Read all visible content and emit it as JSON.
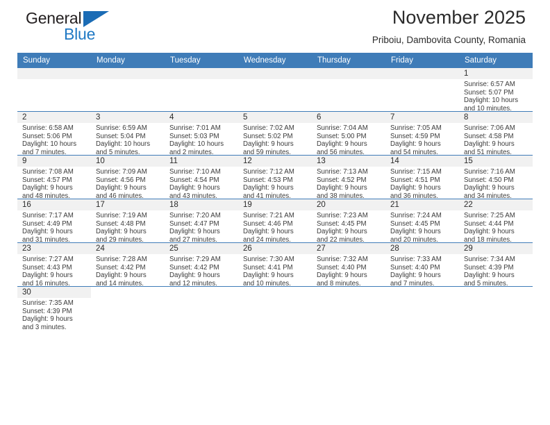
{
  "brand": {
    "name_top": "General",
    "name_bottom": "Blue"
  },
  "header": {
    "title": "November 2025",
    "subtitle": "Priboiu, Dambovita County, Romania"
  },
  "weekdays": [
    "Sunday",
    "Monday",
    "Tuesday",
    "Wednesday",
    "Thursday",
    "Friday",
    "Saturday"
  ],
  "colors": {
    "header_blue": "#3f7cb8",
    "brand_blue": "#2079c4",
    "daynum_strip": "#f1f1f1"
  },
  "weeks": [
    [
      {
        "empty": true
      },
      {
        "empty": true
      },
      {
        "empty": true
      },
      {
        "empty": true
      },
      {
        "empty": true
      },
      {
        "empty": true
      },
      {
        "day": "1",
        "sunrise": "Sunrise: 6:57 AM",
        "sunset": "Sunset: 5:07 PM",
        "daylight1": "Daylight: 10 hours",
        "daylight2": "and 10 minutes."
      }
    ],
    [
      {
        "day": "2",
        "sunrise": "Sunrise: 6:58 AM",
        "sunset": "Sunset: 5:06 PM",
        "daylight1": "Daylight: 10 hours",
        "daylight2": "and 7 minutes."
      },
      {
        "day": "3",
        "sunrise": "Sunrise: 6:59 AM",
        "sunset": "Sunset: 5:04 PM",
        "daylight1": "Daylight: 10 hours",
        "daylight2": "and 5 minutes."
      },
      {
        "day": "4",
        "sunrise": "Sunrise: 7:01 AM",
        "sunset": "Sunset: 5:03 PM",
        "daylight1": "Daylight: 10 hours",
        "daylight2": "and 2 minutes."
      },
      {
        "day": "5",
        "sunrise": "Sunrise: 7:02 AM",
        "sunset": "Sunset: 5:02 PM",
        "daylight1": "Daylight: 9 hours",
        "daylight2": "and 59 minutes."
      },
      {
        "day": "6",
        "sunrise": "Sunrise: 7:04 AM",
        "sunset": "Sunset: 5:00 PM",
        "daylight1": "Daylight: 9 hours",
        "daylight2": "and 56 minutes."
      },
      {
        "day": "7",
        "sunrise": "Sunrise: 7:05 AM",
        "sunset": "Sunset: 4:59 PM",
        "daylight1": "Daylight: 9 hours",
        "daylight2": "and 54 minutes."
      },
      {
        "day": "8",
        "sunrise": "Sunrise: 7:06 AM",
        "sunset": "Sunset: 4:58 PM",
        "daylight1": "Daylight: 9 hours",
        "daylight2": "and 51 minutes."
      }
    ],
    [
      {
        "day": "9",
        "sunrise": "Sunrise: 7:08 AM",
        "sunset": "Sunset: 4:57 PM",
        "daylight1": "Daylight: 9 hours",
        "daylight2": "and 48 minutes."
      },
      {
        "day": "10",
        "sunrise": "Sunrise: 7:09 AM",
        "sunset": "Sunset: 4:56 PM",
        "daylight1": "Daylight: 9 hours",
        "daylight2": "and 46 minutes."
      },
      {
        "day": "11",
        "sunrise": "Sunrise: 7:10 AM",
        "sunset": "Sunset: 4:54 PM",
        "daylight1": "Daylight: 9 hours",
        "daylight2": "and 43 minutes."
      },
      {
        "day": "12",
        "sunrise": "Sunrise: 7:12 AM",
        "sunset": "Sunset: 4:53 PM",
        "daylight1": "Daylight: 9 hours",
        "daylight2": "and 41 minutes."
      },
      {
        "day": "13",
        "sunrise": "Sunrise: 7:13 AM",
        "sunset": "Sunset: 4:52 PM",
        "daylight1": "Daylight: 9 hours",
        "daylight2": "and 38 minutes."
      },
      {
        "day": "14",
        "sunrise": "Sunrise: 7:15 AM",
        "sunset": "Sunset: 4:51 PM",
        "daylight1": "Daylight: 9 hours",
        "daylight2": "and 36 minutes."
      },
      {
        "day": "15",
        "sunrise": "Sunrise: 7:16 AM",
        "sunset": "Sunset: 4:50 PM",
        "daylight1": "Daylight: 9 hours",
        "daylight2": "and 34 minutes."
      }
    ],
    [
      {
        "day": "16",
        "sunrise": "Sunrise: 7:17 AM",
        "sunset": "Sunset: 4:49 PM",
        "daylight1": "Daylight: 9 hours",
        "daylight2": "and 31 minutes."
      },
      {
        "day": "17",
        "sunrise": "Sunrise: 7:19 AM",
        "sunset": "Sunset: 4:48 PM",
        "daylight1": "Daylight: 9 hours",
        "daylight2": "and 29 minutes."
      },
      {
        "day": "18",
        "sunrise": "Sunrise: 7:20 AM",
        "sunset": "Sunset: 4:47 PM",
        "daylight1": "Daylight: 9 hours",
        "daylight2": "and 27 minutes."
      },
      {
        "day": "19",
        "sunrise": "Sunrise: 7:21 AM",
        "sunset": "Sunset: 4:46 PM",
        "daylight1": "Daylight: 9 hours",
        "daylight2": "and 24 minutes."
      },
      {
        "day": "20",
        "sunrise": "Sunrise: 7:23 AM",
        "sunset": "Sunset: 4:45 PM",
        "daylight1": "Daylight: 9 hours",
        "daylight2": "and 22 minutes."
      },
      {
        "day": "21",
        "sunrise": "Sunrise: 7:24 AM",
        "sunset": "Sunset: 4:45 PM",
        "daylight1": "Daylight: 9 hours",
        "daylight2": "and 20 minutes."
      },
      {
        "day": "22",
        "sunrise": "Sunrise: 7:25 AM",
        "sunset": "Sunset: 4:44 PM",
        "daylight1": "Daylight: 9 hours",
        "daylight2": "and 18 minutes."
      }
    ],
    [
      {
        "day": "23",
        "sunrise": "Sunrise: 7:27 AM",
        "sunset": "Sunset: 4:43 PM",
        "daylight1": "Daylight: 9 hours",
        "daylight2": "and 16 minutes."
      },
      {
        "day": "24",
        "sunrise": "Sunrise: 7:28 AM",
        "sunset": "Sunset: 4:42 PM",
        "daylight1": "Daylight: 9 hours",
        "daylight2": "and 14 minutes."
      },
      {
        "day": "25",
        "sunrise": "Sunrise: 7:29 AM",
        "sunset": "Sunset: 4:42 PM",
        "daylight1": "Daylight: 9 hours",
        "daylight2": "and 12 minutes."
      },
      {
        "day": "26",
        "sunrise": "Sunrise: 7:30 AM",
        "sunset": "Sunset: 4:41 PM",
        "daylight1": "Daylight: 9 hours",
        "daylight2": "and 10 minutes."
      },
      {
        "day": "27",
        "sunrise": "Sunrise: 7:32 AM",
        "sunset": "Sunset: 4:40 PM",
        "daylight1": "Daylight: 9 hours",
        "daylight2": "and 8 minutes."
      },
      {
        "day": "28",
        "sunrise": "Sunrise: 7:33 AM",
        "sunset": "Sunset: 4:40 PM",
        "daylight1": "Daylight: 9 hours",
        "daylight2": "and 7 minutes."
      },
      {
        "day": "29",
        "sunrise": "Sunrise: 7:34 AM",
        "sunset": "Sunset: 4:39 PM",
        "daylight1": "Daylight: 9 hours",
        "daylight2": "and 5 minutes."
      }
    ],
    [
      {
        "day": "30",
        "sunrise": "Sunrise: 7:35 AM",
        "sunset": "Sunset: 4:39 PM",
        "daylight1": "Daylight: 9 hours",
        "daylight2": "and 3 minutes."
      },
      {
        "blank": true
      },
      {
        "blank": true
      },
      {
        "blank": true
      },
      {
        "blank": true
      },
      {
        "blank": true
      },
      {
        "blank": true
      }
    ]
  ]
}
